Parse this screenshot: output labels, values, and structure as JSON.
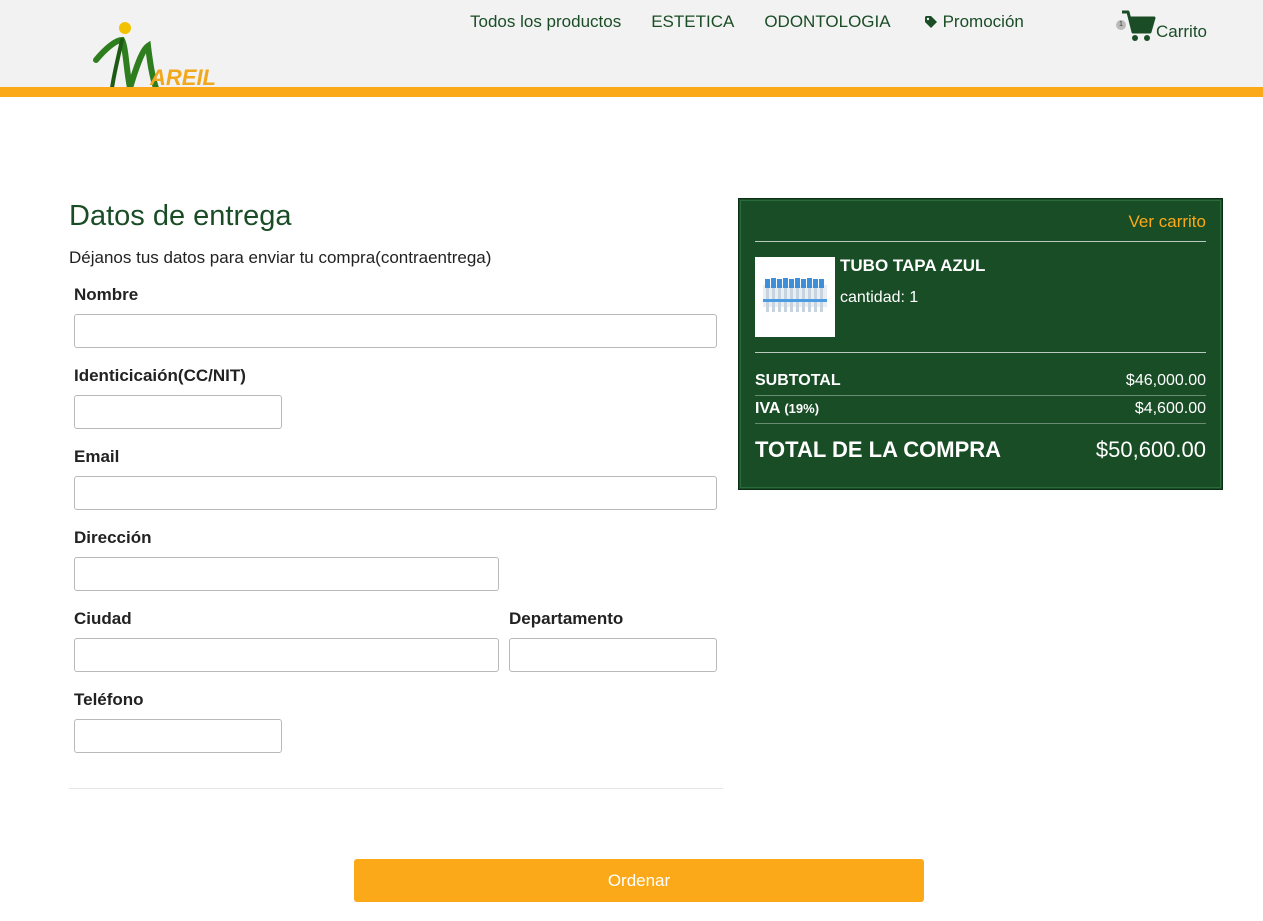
{
  "header": {
    "logo_text": "AREIL",
    "nav": [
      {
        "label": "Todos los productos"
      },
      {
        "label": "ESTETICA"
      },
      {
        "label": "ODONTOLOGIA"
      },
      {
        "label": "Promoción",
        "icon": "tag-icon"
      }
    ],
    "cart": {
      "label": "Carrito",
      "count": "1",
      "icon": "shopping-cart-icon"
    }
  },
  "form": {
    "title": "Datos de entrega",
    "subtitle": "Déjanos tus datos para enviar tu compra(contraentrega)",
    "fields": {
      "nombre": {
        "label": "Nombre",
        "value": ""
      },
      "identificacion": {
        "label": "Identicicaión(CC/NIT)",
        "value": ""
      },
      "email": {
        "label": "Email",
        "value": ""
      },
      "direccion": {
        "label": "Dirección",
        "value": ""
      },
      "ciudad": {
        "label": "Ciudad",
        "value": ""
      },
      "departamento": {
        "label": "Departamento",
        "value": ""
      },
      "telefono": {
        "label": "Teléfono",
        "value": ""
      }
    },
    "submit_label": "Ordenar"
  },
  "summary": {
    "view_cart_label": "Ver carrito",
    "item": {
      "name": "TUBO TAPA AZUL",
      "quantity": "cantidad: 1"
    },
    "subtotal_label": "SUBTOTAL",
    "subtotal_value": "$46,000.00",
    "iva_label": "IVA",
    "iva_rate": "(19%)",
    "iva_value": "$4,600.00",
    "total_label": "TOTAL DE LA COMPRA",
    "total_value": "$50,600.00"
  },
  "colors": {
    "brand_green": "#194d26",
    "accent_orange": "#fba918",
    "header_bg": "#f2f2f2"
  }
}
